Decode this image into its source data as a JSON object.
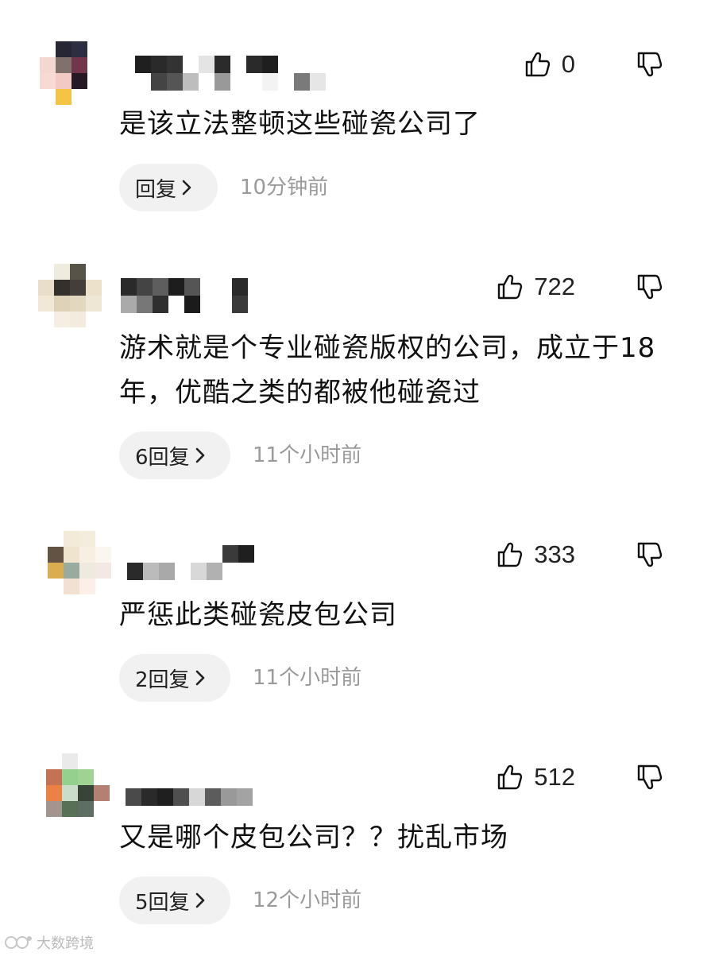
{
  "comments": [
    {
      "likes": "0",
      "text": "是该立法整顿这些碰瓷公司了",
      "reply_label": "回复",
      "time": "10分钟前"
    },
    {
      "likes": "722",
      "text": "游术就是个专业碰瓷版权的公司，成立于18年，优酷之类的都被他碰瓷过",
      "reply_label": "6回复",
      "time": "11个小时前"
    },
    {
      "likes": "333",
      "text": "严惩此类碰瓷皮包公司",
      "reply_label": "2回复",
      "time": "11个小时前"
    },
    {
      "likes": "512",
      "text": "又是哪个皮包公司？？扰乱市场",
      "reply_label": "5回复",
      "time": "12个小时前"
    }
  ],
  "icons": {
    "like": "thumbs-up-icon",
    "dislike": "thumbs-down-icon",
    "reply_chevron": "chevron-right-icon"
  },
  "watermark": {
    "text": "大数跨境"
  },
  "colors": {
    "text": "#111111",
    "secondary": "#9a9a9a",
    "pill": "#f1f1f1"
  }
}
